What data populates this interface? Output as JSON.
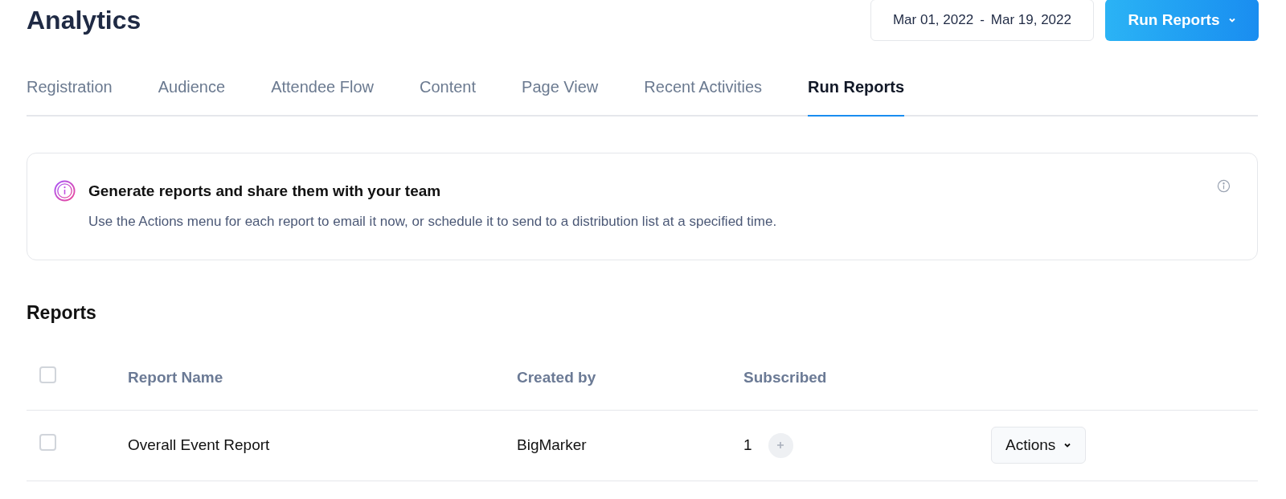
{
  "header": {
    "title": "Analytics",
    "date_range": {
      "start": "Mar 01, 2022",
      "separator": "-",
      "end": "Mar 19, 2022"
    },
    "run_reports_button": "Run Reports"
  },
  "tabs": [
    {
      "label": "Registration",
      "selected": false
    },
    {
      "label": "Audience",
      "selected": false
    },
    {
      "label": "Attendee Flow",
      "selected": false
    },
    {
      "label": "Content",
      "selected": false
    },
    {
      "label": "Page View",
      "selected": false
    },
    {
      "label": "Recent Activities",
      "selected": false
    },
    {
      "label": "Run Reports",
      "selected": true
    }
  ],
  "info_card": {
    "title": "Generate reports and share them with your team",
    "text": "Use the Actions menu for each report to email it now, or schedule it to send to a distribution list at a specified time."
  },
  "reports": {
    "heading": "Reports",
    "select_all_checked": false,
    "columns": [
      "Report Name",
      "Created by",
      "Subscribed"
    ],
    "rows": [
      {
        "checked": false,
        "name": "Overall Event Report",
        "created_by": "BigMarker",
        "subscribed": "1",
        "actions": "Actions"
      }
    ]
  }
}
